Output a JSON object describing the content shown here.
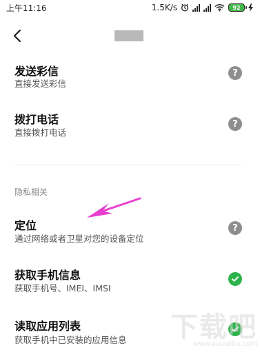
{
  "status_bar": {
    "time": "上午11:16",
    "speed": "1.5K/s",
    "battery": "92"
  },
  "items": [
    {
      "title": "发送彩信",
      "desc": "直接发送彩信",
      "status": "question"
    },
    {
      "title": "拨打电话",
      "desc": "直接拨打电话",
      "status": "question"
    },
    {
      "title": "定位",
      "desc": "通过网络或者卫星对您的设备定位",
      "status": "question"
    },
    {
      "title": "获取手机信息",
      "desc": "获取手机号、IMEI、IMSI",
      "status": "allowed"
    },
    {
      "title": "读取应用列表",
      "desc": "获取手机中已安装的应用信息",
      "status": "allowed"
    }
  ],
  "section": {
    "privacy_label": "隐私相关"
  },
  "icons": {
    "question_mark": "?",
    "back": "chevron-left-icon",
    "allowed": "checkmark-icon"
  },
  "colors": {
    "allowed": "#2eb34c",
    "question": "#8e8e8e",
    "arrow": "#e83fd0"
  },
  "watermark": {
    "main": "下载吧",
    "sub": "www.xiazaiba.com"
  }
}
